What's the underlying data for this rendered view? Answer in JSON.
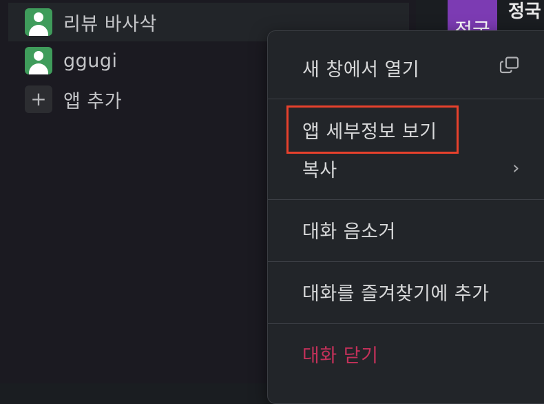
{
  "sidebar": {
    "items": [
      {
        "label": "리뷰 바사삭",
        "icon": "user-avatar-icon"
      },
      {
        "label": "ggugi",
        "icon": "user-avatar-icon"
      },
      {
        "label": "앱 추가",
        "icon": "plus-icon"
      }
    ]
  },
  "channel": {
    "avatar_text": "정국",
    "name": "정국"
  },
  "context_menu": {
    "items": [
      {
        "label": "새 창에서 열기",
        "trailing_icon": "open-in-new-window-icon"
      },
      {
        "label": "앱 세부정보 보기"
      },
      {
        "label": "복사",
        "trailing_icon": "chevron-right-icon",
        "trailing_text": "›"
      },
      {
        "label": "대화 음소거"
      },
      {
        "label": "대화를 즐겨찾기에 추가"
      },
      {
        "label": "대화 닫기",
        "color": "#c4315a"
      }
    ]
  },
  "colors": {
    "highlight_border": "#e8412c",
    "avatar_green": "#3f9c5b",
    "channel_purple": "#7c3bb3",
    "danger_text": "#c4315a"
  }
}
